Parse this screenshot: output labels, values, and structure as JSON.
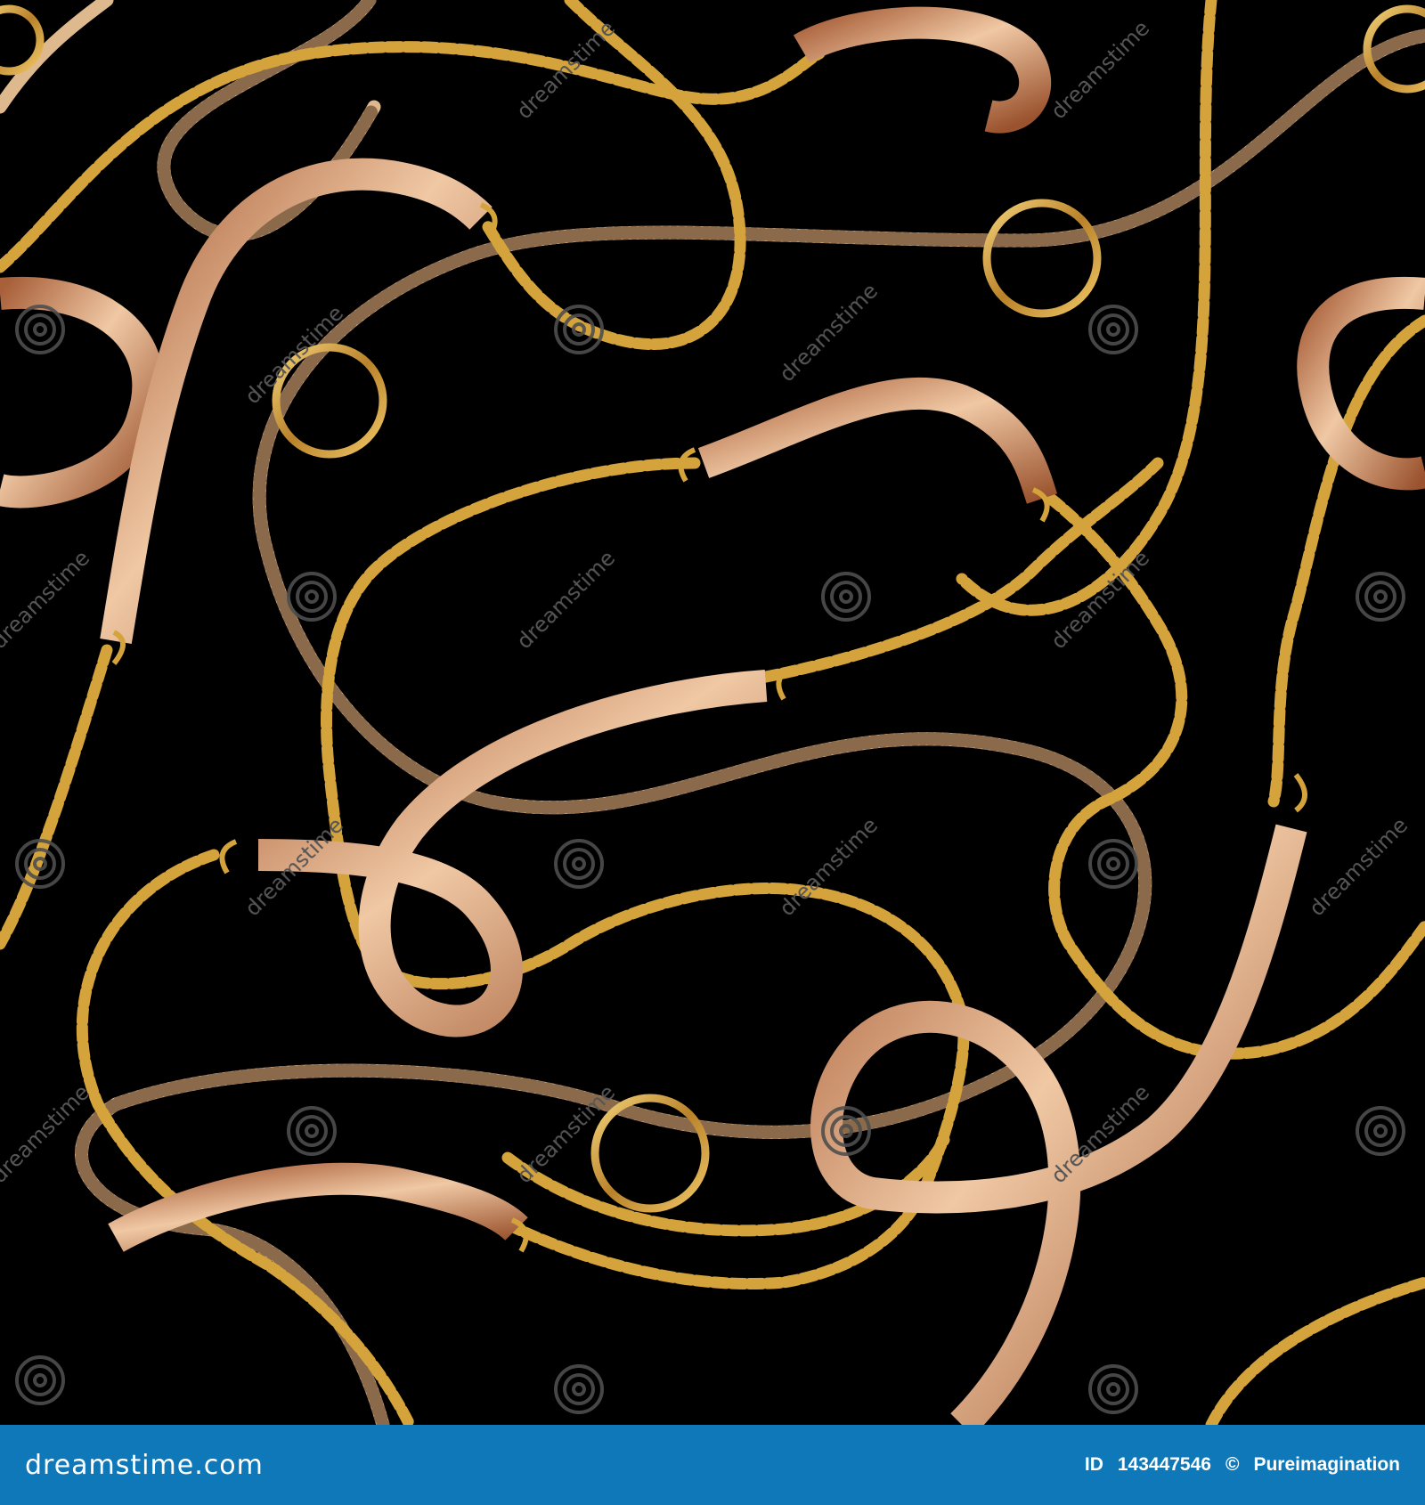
{
  "watermark": {
    "text": "dreamstime"
  },
  "footer": {
    "logo": "dreamstime.com",
    "id_label": "ID",
    "id_value": "143447546",
    "copyright": "©",
    "author": "Pureimagination"
  },
  "colors": {
    "background": "#000000",
    "footer_background": "#0f78b9",
    "footer_text": "#ffffff",
    "gold": "#d4a33b",
    "rope": "#dfb98e",
    "belt": "#c9835a"
  }
}
